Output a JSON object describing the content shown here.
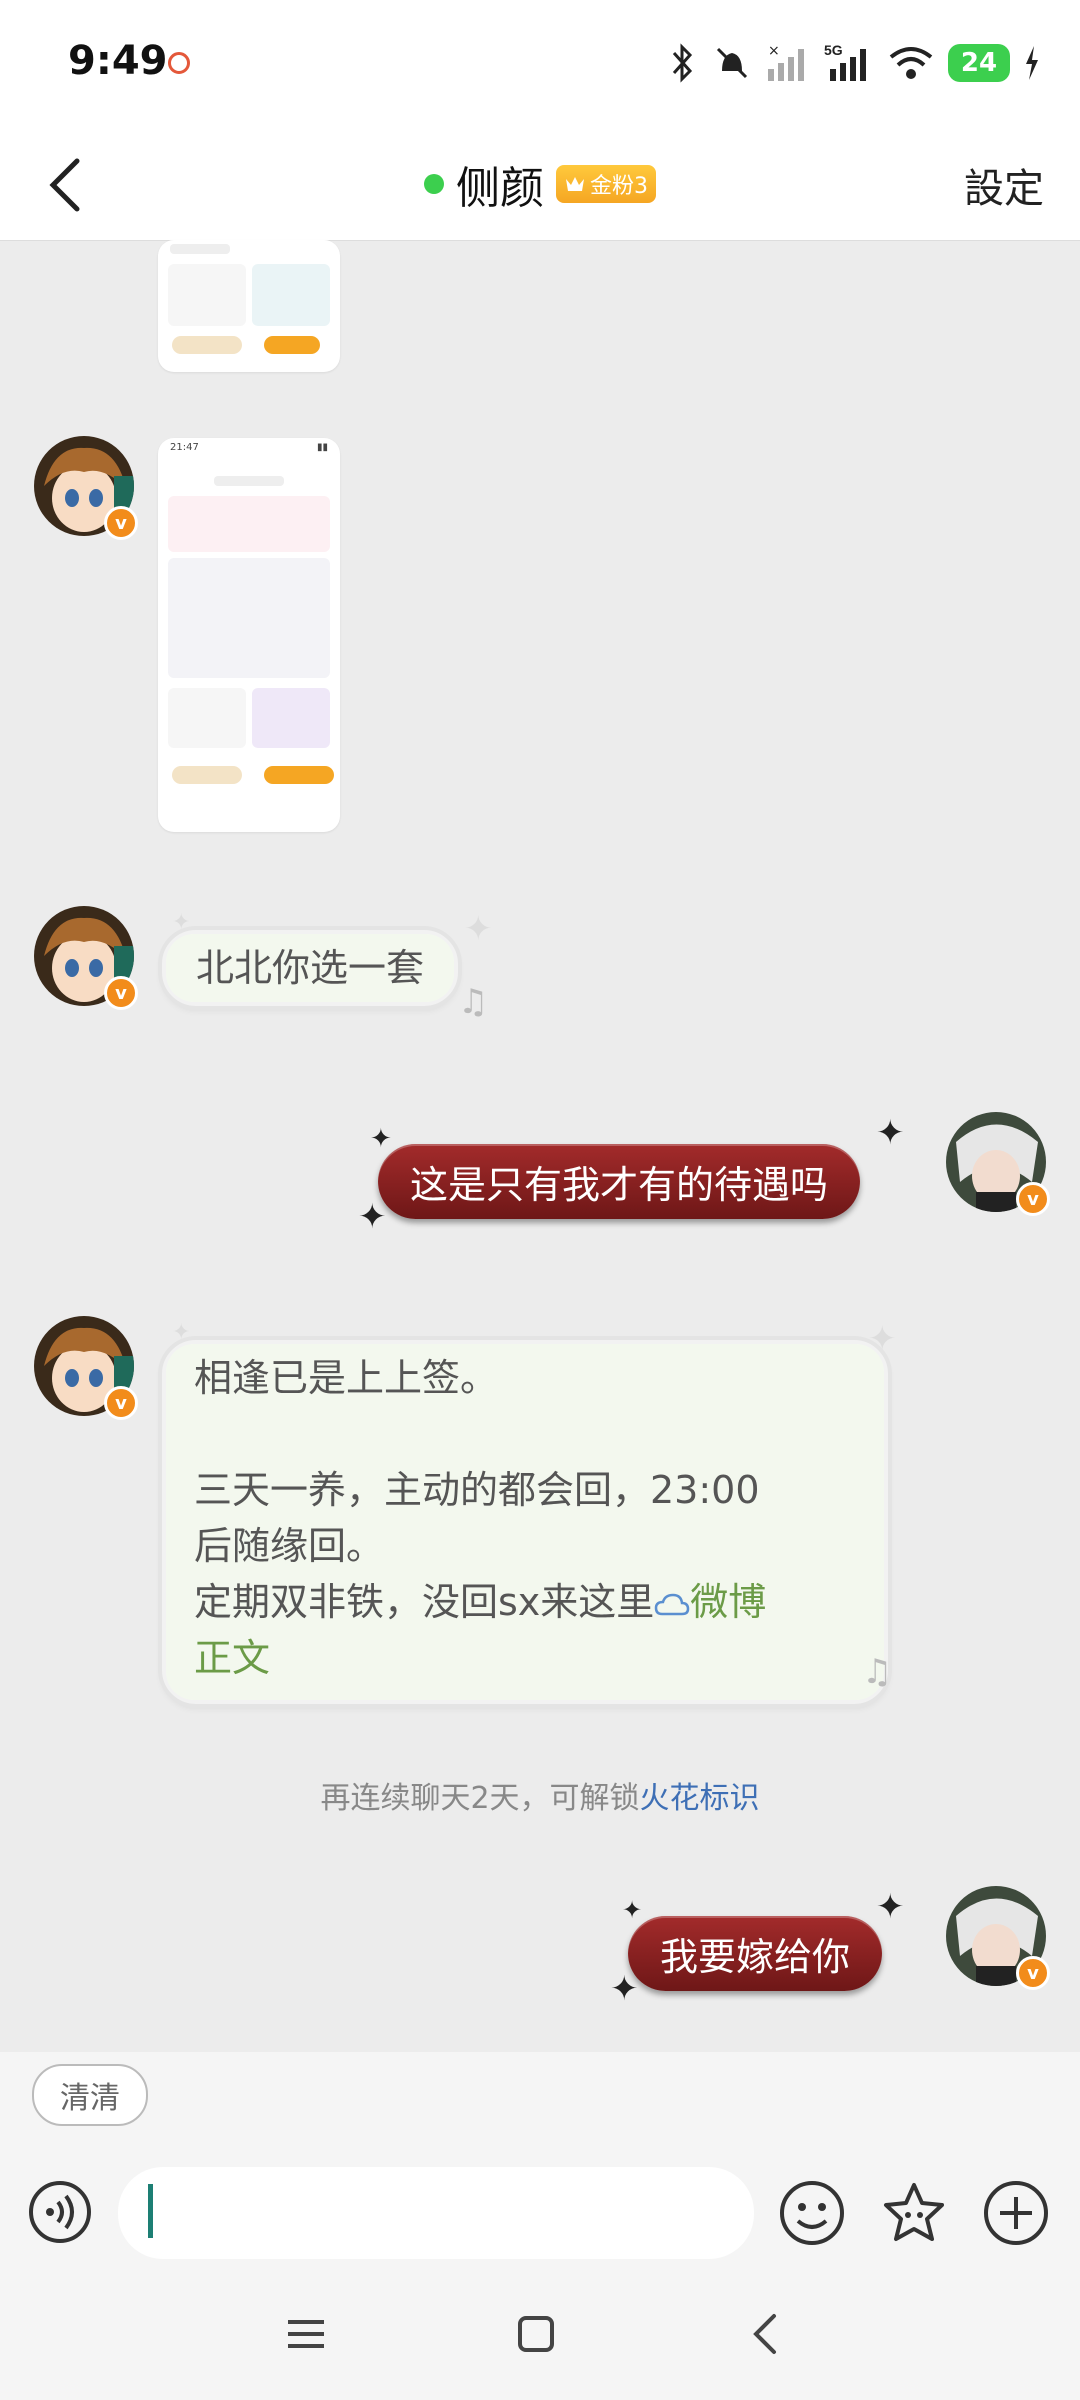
{
  "status_bar": {
    "time": "9:49",
    "network": "5G",
    "battery": "24"
  },
  "header": {
    "title": "侧颜",
    "fan_badge": "金粉3",
    "settings": "設定"
  },
  "messages": [
    {
      "side": "left",
      "text": "北北你选一套"
    },
    {
      "side": "right",
      "text": "这是只有我才有的待遇吗"
    },
    {
      "side": "left",
      "lines": [
        "相逢已是上上签。",
        "",
        "三天一养，主动的都会回，23:00",
        "后随缘回。",
        "定期双非铁，没回sx来这里"
      ],
      "link_text": "微博",
      "link_tail": "正文"
    },
    {
      "side": "right",
      "text": "我要嫁给你"
    }
  ],
  "system_notice": {
    "prefix": "再连续聊天2天，可解锁",
    "link": "火花标识"
  },
  "input": {
    "quick_reply": "清清",
    "placeholder": ""
  },
  "colors": {
    "accent_red": "#8b1f1f",
    "online": "#3ccf4e",
    "link_green": "#6b9b47",
    "link_blue": "#3e6fb5",
    "badge_orange": "#f5a623"
  }
}
